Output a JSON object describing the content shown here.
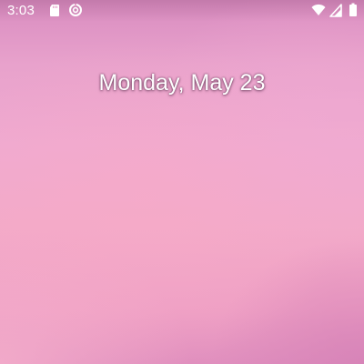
{
  "status_bar": {
    "time": "3:03",
    "left_icons": [
      "sd-card-icon",
      "data-saver-icon"
    ],
    "right_icons": [
      "wifi-icon",
      "cellular-signal-icon",
      "battery-icon"
    ]
  },
  "lockscreen": {
    "date": "Monday, May 23"
  },
  "colors": {
    "wallpaper_top": "#d98cc0",
    "wallpaper_mid": "#f0aad0",
    "wallpaper_bottom": "#e08fbe",
    "text": "#ffffff"
  }
}
